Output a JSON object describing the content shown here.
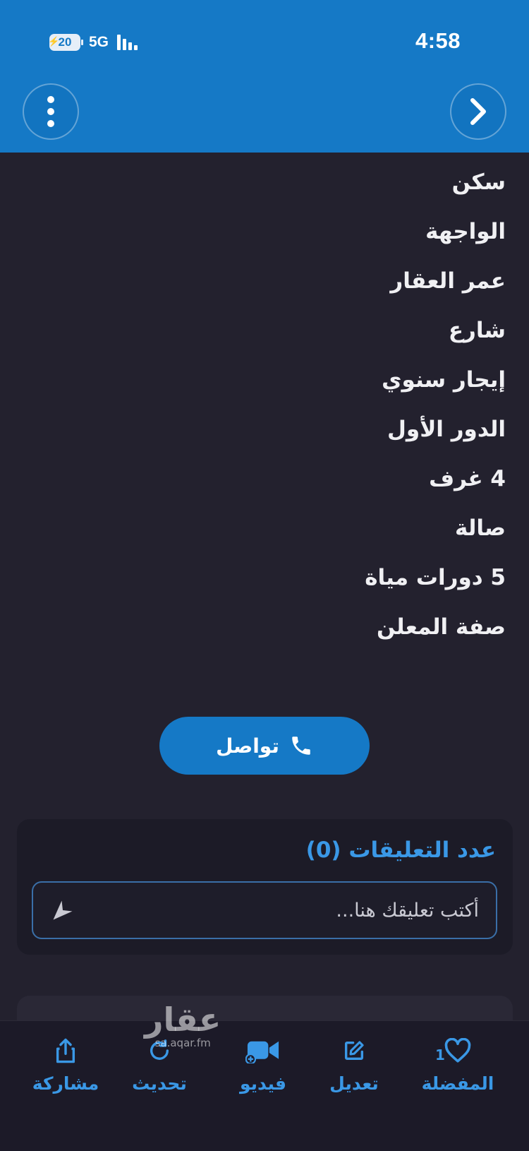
{
  "status_bar": {
    "battery": "20",
    "network": "5G",
    "time": "4:58"
  },
  "header": {
    "menu_icon": "more-vertical-icon",
    "back_icon": "chevron-right-icon"
  },
  "details": [
    "سكن",
    "الواجهة",
    "عمر العقار",
    "شارع",
    "إيجار سنوي",
    "الدور الأول",
    "4 غرف",
    "صالة",
    "5 دورات مياة",
    "صفة المعلن"
  ],
  "contact_button": {
    "label": "تواصل",
    "icon": "phone-icon"
  },
  "comments": {
    "title": "عدد التعليقات (0)",
    "placeholder": "أكتب تعليقك هنا..."
  },
  "bottom_nav": {
    "share": "مشاركة",
    "refresh": "تحديث",
    "video": "فيديو",
    "edit": "تعديل",
    "favorites": "المفضلة",
    "favorites_count": "1"
  },
  "watermark": {
    "arabic": "عقار",
    "url": "sa.aqar.fm"
  },
  "colors": {
    "accent": "#1579c6",
    "background": "#23212e",
    "link": "#3a98e6"
  }
}
